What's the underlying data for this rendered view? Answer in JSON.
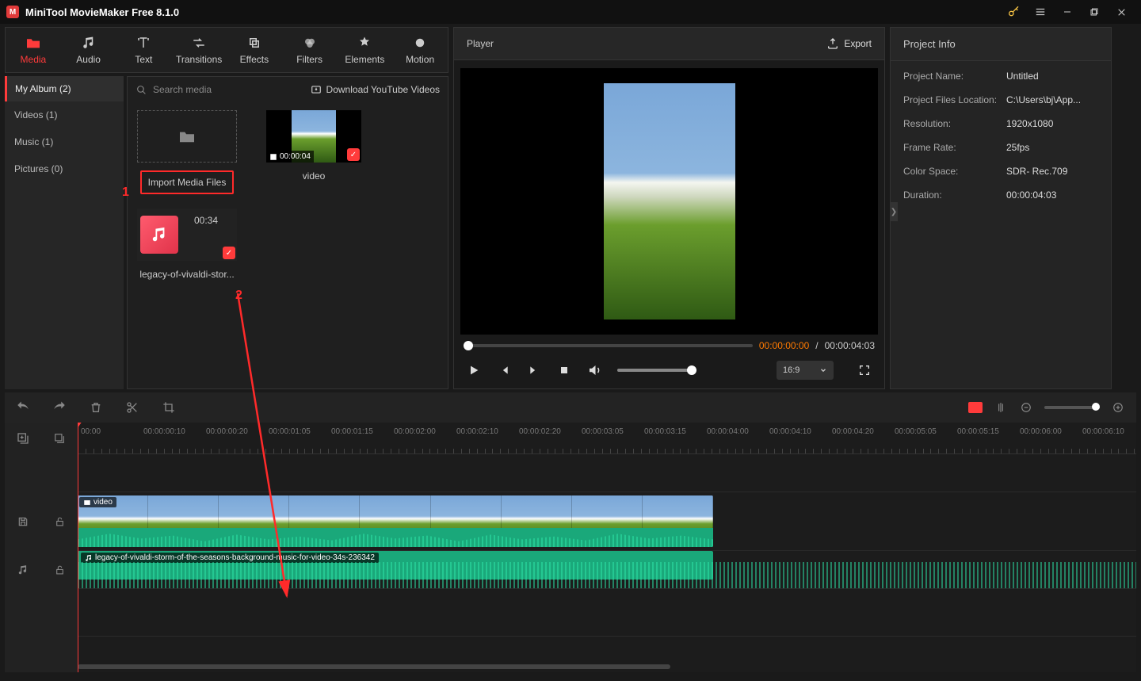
{
  "app": {
    "title": "MiniTool MovieMaker Free 8.1.0"
  },
  "tabs": [
    {
      "label": "Media"
    },
    {
      "label": "Audio"
    },
    {
      "label": "Text"
    },
    {
      "label": "Transitions"
    },
    {
      "label": "Effects"
    },
    {
      "label": "Filters"
    },
    {
      "label": "Elements"
    },
    {
      "label": "Motion"
    }
  ],
  "album": {
    "header": "My Album (2)",
    "items": [
      "Videos (1)",
      "Music (1)",
      "Pictures (0)"
    ]
  },
  "mediaToolbar": {
    "searchPlaceholder": "Search media",
    "downloadLabel": "Download YouTube Videos"
  },
  "mediaItems": {
    "importLabel": "Import Media Files",
    "video": {
      "duration": "00:00:04",
      "name": "video"
    },
    "music": {
      "duration": "00:34",
      "name": "legacy-of-vivaldi-stor..."
    }
  },
  "annotations": {
    "one": "1",
    "two": "2"
  },
  "player": {
    "title": "Player",
    "exportLabel": "Export",
    "currentTime": "00:00:00:00",
    "sep": " / ",
    "totalTime": "00:00:04:03",
    "aspect": "16:9"
  },
  "projectInfo": {
    "title": "Project Info",
    "rows": [
      {
        "k": "Project Name:",
        "v": "Untitled"
      },
      {
        "k": "Project Files Location:",
        "v": "C:\\Users\\bj\\App..."
      },
      {
        "k": "Resolution:",
        "v": "1920x1080"
      },
      {
        "k": "Frame Rate:",
        "v": "25fps"
      },
      {
        "k": "Color Space:",
        "v": "SDR- Rec.709"
      },
      {
        "k": "Duration:",
        "v": "00:00:04:03"
      }
    ]
  },
  "timeline": {
    "ticks": [
      "00:00",
      "00:00:00:10",
      "00:00:00:20",
      "00:00:01:05",
      "00:00:01:15",
      "00:00:02:00",
      "00:00:02:10",
      "00:00:02:20",
      "00:00:03:05",
      "00:00:03:15",
      "00:00:04:00",
      "00:00:04:10",
      "00:00:04:20",
      "00:00:05:05",
      "00:00:05:15",
      "00:00:06:00",
      "00:00:06:10"
    ],
    "videoClipLabel": "video",
    "audioClipLabel": "legacy-of-vivaldi-storm-of-the-seasons-background-music-for-video-34s-236342"
  }
}
